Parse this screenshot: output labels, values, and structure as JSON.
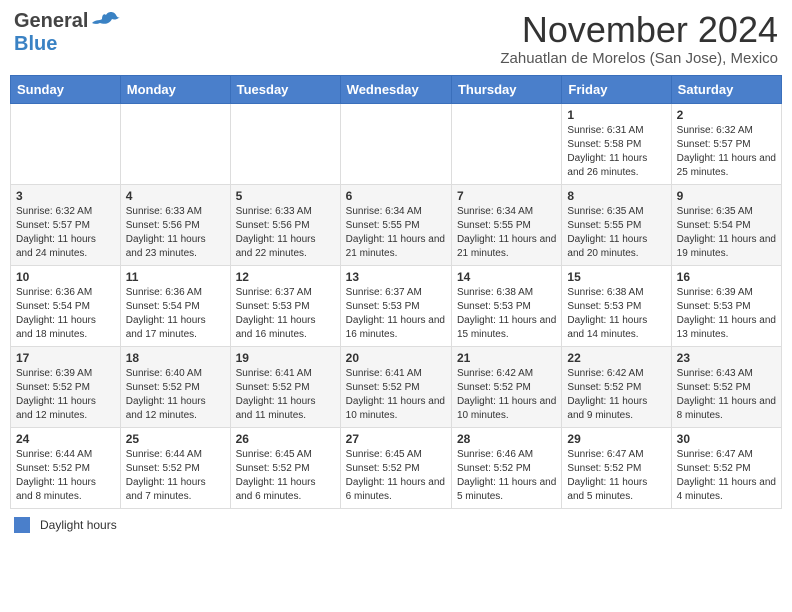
{
  "header": {
    "logo_general": "General",
    "logo_blue": "Blue",
    "month_title": "November 2024",
    "location": "Zahuatlan de Morelos (San Jose), Mexico"
  },
  "weekdays": [
    "Sunday",
    "Monday",
    "Tuesday",
    "Wednesday",
    "Thursday",
    "Friday",
    "Saturday"
  ],
  "weeks": [
    [
      {
        "day": "",
        "info": ""
      },
      {
        "day": "",
        "info": ""
      },
      {
        "day": "",
        "info": ""
      },
      {
        "day": "",
        "info": ""
      },
      {
        "day": "",
        "info": ""
      },
      {
        "day": "1",
        "info": "Sunrise: 6:31 AM\nSunset: 5:58 PM\nDaylight: 11 hours and 26 minutes."
      },
      {
        "day": "2",
        "info": "Sunrise: 6:32 AM\nSunset: 5:57 PM\nDaylight: 11 hours and 25 minutes."
      }
    ],
    [
      {
        "day": "3",
        "info": "Sunrise: 6:32 AM\nSunset: 5:57 PM\nDaylight: 11 hours and 24 minutes."
      },
      {
        "day": "4",
        "info": "Sunrise: 6:33 AM\nSunset: 5:56 PM\nDaylight: 11 hours and 23 minutes."
      },
      {
        "day": "5",
        "info": "Sunrise: 6:33 AM\nSunset: 5:56 PM\nDaylight: 11 hours and 22 minutes."
      },
      {
        "day": "6",
        "info": "Sunrise: 6:34 AM\nSunset: 5:55 PM\nDaylight: 11 hours and 21 minutes."
      },
      {
        "day": "7",
        "info": "Sunrise: 6:34 AM\nSunset: 5:55 PM\nDaylight: 11 hours and 21 minutes."
      },
      {
        "day": "8",
        "info": "Sunrise: 6:35 AM\nSunset: 5:55 PM\nDaylight: 11 hours and 20 minutes."
      },
      {
        "day": "9",
        "info": "Sunrise: 6:35 AM\nSunset: 5:54 PM\nDaylight: 11 hours and 19 minutes."
      }
    ],
    [
      {
        "day": "10",
        "info": "Sunrise: 6:36 AM\nSunset: 5:54 PM\nDaylight: 11 hours and 18 minutes."
      },
      {
        "day": "11",
        "info": "Sunrise: 6:36 AM\nSunset: 5:54 PM\nDaylight: 11 hours and 17 minutes."
      },
      {
        "day": "12",
        "info": "Sunrise: 6:37 AM\nSunset: 5:53 PM\nDaylight: 11 hours and 16 minutes."
      },
      {
        "day": "13",
        "info": "Sunrise: 6:37 AM\nSunset: 5:53 PM\nDaylight: 11 hours and 16 minutes."
      },
      {
        "day": "14",
        "info": "Sunrise: 6:38 AM\nSunset: 5:53 PM\nDaylight: 11 hours and 15 minutes."
      },
      {
        "day": "15",
        "info": "Sunrise: 6:38 AM\nSunset: 5:53 PM\nDaylight: 11 hours and 14 minutes."
      },
      {
        "day": "16",
        "info": "Sunrise: 6:39 AM\nSunset: 5:53 PM\nDaylight: 11 hours and 13 minutes."
      }
    ],
    [
      {
        "day": "17",
        "info": "Sunrise: 6:39 AM\nSunset: 5:52 PM\nDaylight: 11 hours and 12 minutes."
      },
      {
        "day": "18",
        "info": "Sunrise: 6:40 AM\nSunset: 5:52 PM\nDaylight: 11 hours and 12 minutes."
      },
      {
        "day": "19",
        "info": "Sunrise: 6:41 AM\nSunset: 5:52 PM\nDaylight: 11 hours and 11 minutes."
      },
      {
        "day": "20",
        "info": "Sunrise: 6:41 AM\nSunset: 5:52 PM\nDaylight: 11 hours and 10 minutes."
      },
      {
        "day": "21",
        "info": "Sunrise: 6:42 AM\nSunset: 5:52 PM\nDaylight: 11 hours and 10 minutes."
      },
      {
        "day": "22",
        "info": "Sunrise: 6:42 AM\nSunset: 5:52 PM\nDaylight: 11 hours and 9 minutes."
      },
      {
        "day": "23",
        "info": "Sunrise: 6:43 AM\nSunset: 5:52 PM\nDaylight: 11 hours and 8 minutes."
      }
    ],
    [
      {
        "day": "24",
        "info": "Sunrise: 6:44 AM\nSunset: 5:52 PM\nDaylight: 11 hours and 8 minutes."
      },
      {
        "day": "25",
        "info": "Sunrise: 6:44 AM\nSunset: 5:52 PM\nDaylight: 11 hours and 7 minutes."
      },
      {
        "day": "26",
        "info": "Sunrise: 6:45 AM\nSunset: 5:52 PM\nDaylight: 11 hours and 6 minutes."
      },
      {
        "day": "27",
        "info": "Sunrise: 6:45 AM\nSunset: 5:52 PM\nDaylight: 11 hours and 6 minutes."
      },
      {
        "day": "28",
        "info": "Sunrise: 6:46 AM\nSunset: 5:52 PM\nDaylight: 11 hours and 5 minutes."
      },
      {
        "day": "29",
        "info": "Sunrise: 6:47 AM\nSunset: 5:52 PM\nDaylight: 11 hours and 5 minutes."
      },
      {
        "day": "30",
        "info": "Sunrise: 6:47 AM\nSunset: 5:52 PM\nDaylight: 11 hours and 4 minutes."
      }
    ]
  ],
  "footer": {
    "legend_label": "Daylight hours"
  }
}
